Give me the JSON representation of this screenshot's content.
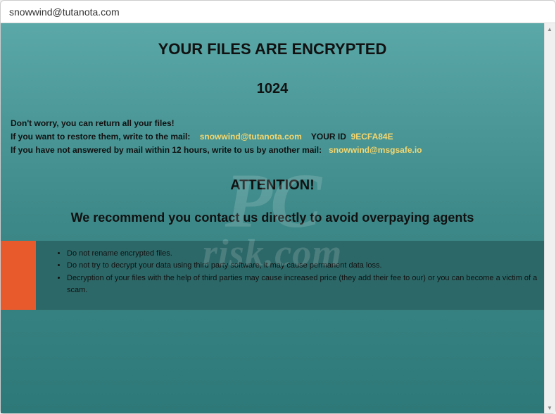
{
  "titlebar": {
    "title": "snowwind@tutanota.com"
  },
  "content": {
    "heading": "YOUR FILES ARE ENCRYPTED",
    "code": "1024",
    "line1": "Don't worry, you can return all your files!",
    "line2_prefix": "If you want to restore them, write to the mail:",
    "email1": "snowwind@tutanota.com",
    "id_label": "YOUR ID",
    "victim_id": "9ECFA84E",
    "line3_prefix": "If you have not answered by mail within 12 hours, write to us by another mail:",
    "email2": "snowwind@msgsafe.io",
    "attention": "ATTENTION!",
    "recommendation": "We recommend you contact us directly to avoid overpaying agents",
    "warnings": [
      "Do not rename encrypted files.",
      "Do not try to decrypt your data using third party software, it may cause permanent data loss.",
      "Decryption of your files with the help of third parties may cause increased price (they add their fee to our) or you can become a victim of a scam."
    ]
  },
  "watermark": {
    "main": "PC",
    "sub": "risk.com"
  }
}
